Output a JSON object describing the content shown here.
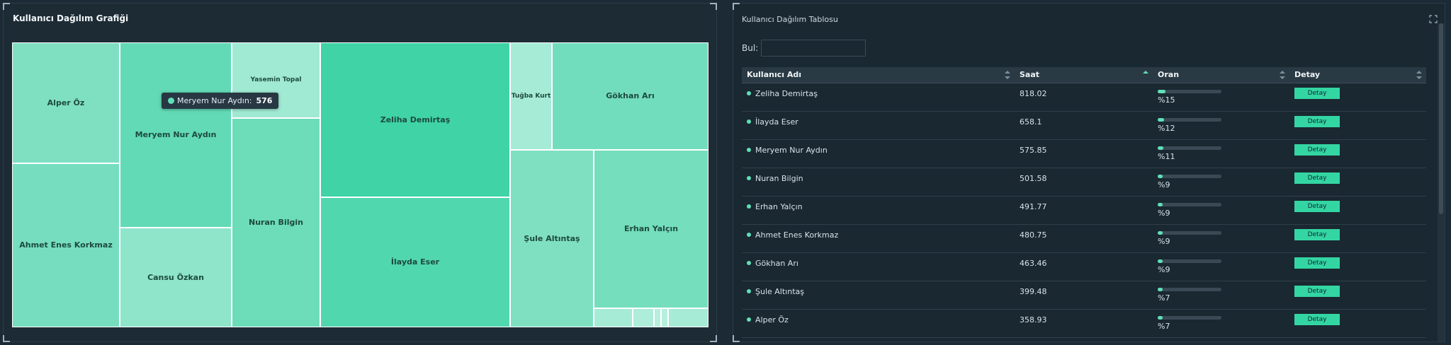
{
  "left_panel": {
    "title": "Kullanıcı Dağılım Grafiği"
  },
  "tooltip": {
    "label": "Meryem Nur Aydın:",
    "value": "576"
  },
  "chart_data": {
    "type": "treemap",
    "items": [
      {
        "name": "Zeliha Demirtaş",
        "value": 818.02
      },
      {
        "name": "İlayda Eser",
        "value": 658.1
      },
      {
        "name": "Meryem Nur Aydın",
        "value": 575.85
      },
      {
        "name": "Nuran Bilgin",
        "value": 501.58
      },
      {
        "name": "Erhan Yalçın",
        "value": 491.77
      },
      {
        "name": "Ahmet Enes Korkmaz",
        "value": 480.75
      },
      {
        "name": "Gökhan Arı",
        "value": 463.46
      },
      {
        "name": "Şule Altıntaş",
        "value": 399.48
      },
      {
        "name": "Alper Öz",
        "value": 358.93
      },
      {
        "name": "Cansu Özkan",
        "value": null
      },
      {
        "name": "Yasemin Topal",
        "value": null
      },
      {
        "name": "Tuğba Kurt",
        "value": null
      }
    ]
  },
  "tiles": {
    "alper": "Alper Öz",
    "ahmet": "Ahmet Enes Korkmaz",
    "meryem": "Meryem Nur Aydın",
    "cansu": "Cansu Özkan",
    "yasemin": "Yasemin Topal",
    "nuran": "Nuran Bilgin",
    "zeliha": "Zeliha Demirtaş",
    "ilayda": "İlayda Eser",
    "tugba": "Tuğba Kurt",
    "gokhan": "Gökhan Arı",
    "sule": "Şule Altıntaş",
    "erhan": "Erhan Yalçın"
  },
  "right_panel": {
    "title": "Kullanıcı Dağılım Tablosu",
    "search_label": "Bul:",
    "search_value": "",
    "columns": [
      "Kullanıcı Adı",
      "Saat",
      "Oran",
      "Detay"
    ],
    "button_label": "Detay",
    "rows": [
      {
        "name": "Zeliha Demirtaş",
        "saat": "818.02",
        "oran": "%15",
        "pct": 15
      },
      {
        "name": "İlayda Eser",
        "saat": "658.1",
        "oran": "%12",
        "pct": 12
      },
      {
        "name": "Meryem Nur Aydın",
        "saat": "575.85",
        "oran": "%11",
        "pct": 11
      },
      {
        "name": "Nuran Bilgin",
        "saat": "501.58",
        "oran": "%9",
        "pct": 9
      },
      {
        "name": "Erhan Yalçın",
        "saat": "491.77",
        "oran": "%9",
        "pct": 9
      },
      {
        "name": "Ahmet Enes Korkmaz",
        "saat": "480.75",
        "oran": "%9",
        "pct": 9
      },
      {
        "name": "Gökhan Arı",
        "saat": "463.46",
        "oran": "%9",
        "pct": 9
      },
      {
        "name": "Şule Altıntaş",
        "saat": "399.48",
        "oran": "%7",
        "pct": 7
      },
      {
        "name": "Alper Öz",
        "saat": "358.93",
        "oran": "%7",
        "pct": 7
      }
    ]
  },
  "colors": {
    "accent": "#33d6a2",
    "panel": "#1d2b35",
    "header": "#2a3a44"
  }
}
